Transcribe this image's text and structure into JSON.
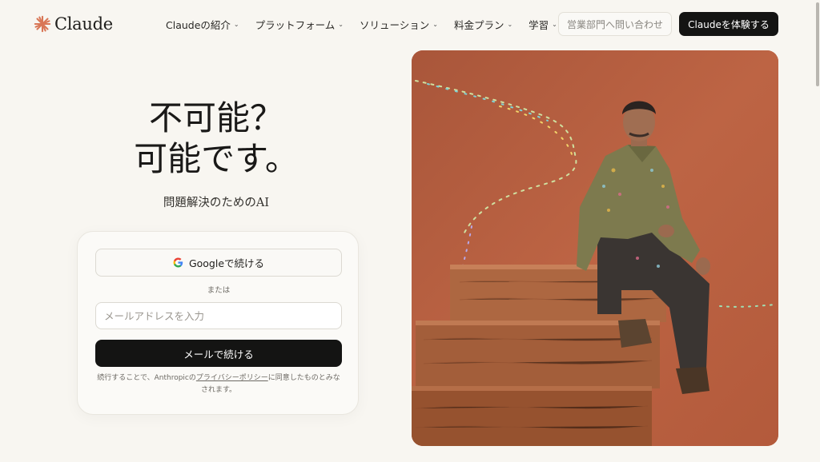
{
  "brand": {
    "name": "Claude",
    "accent": "#d97757"
  },
  "nav": {
    "items": [
      {
        "label": "Claudeの紹介"
      },
      {
        "label": "プラットフォーム"
      },
      {
        "label": "ソリューション"
      },
      {
        "label": "料金プラン"
      },
      {
        "label": "学習"
      }
    ],
    "sales_button": "営業部門へ問い合わせ",
    "try_button": "Claudeを体験する"
  },
  "hero": {
    "title_line1": "不可能？",
    "title_line2": "可能です。",
    "subtitle": "問題解決のためのAI"
  },
  "login": {
    "google_button": "Googleで続ける",
    "or_text": "または",
    "email_placeholder": "メールアドレスを入力",
    "email_value": "",
    "email_button": "メールで続ける",
    "terms_prefix": "続行することで、Anthropicの",
    "terms_link": "プライバシーポリシー",
    "terms_suffix": "に同意したものとみなされます。"
  },
  "colors": {
    "background": "#f8f6f1",
    "primary_button": "#141413",
    "image_backdrop": "#b55d3d"
  }
}
